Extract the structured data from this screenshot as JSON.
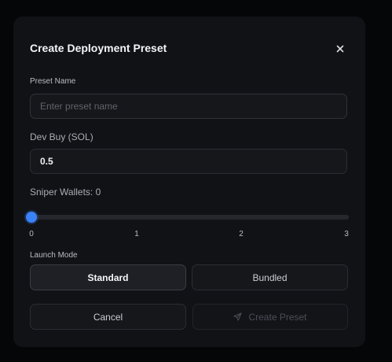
{
  "dialog": {
    "title": "Create Deployment Preset",
    "close_icon": "close-icon"
  },
  "preset_name": {
    "label": "Preset Name",
    "value": "",
    "placeholder": "Enter preset name"
  },
  "dev_buy": {
    "label": "Dev Buy (SOL)",
    "value": "0.5"
  },
  "sniper_wallets": {
    "label": "Sniper Wallets: 0",
    "value": 0,
    "min": 0,
    "max": 3,
    "ticks": [
      "0",
      "1",
      "2",
      "3"
    ]
  },
  "launch_mode": {
    "label": "Launch Mode",
    "options": [
      "Standard",
      "Bundled"
    ],
    "selected": "Standard"
  },
  "actions": {
    "cancel_label": "Cancel",
    "create_label": "Create Preset",
    "create_icon": "send-icon"
  },
  "colors": {
    "accent": "#3b82f6",
    "modal_bg": "#111216",
    "page_bg": "#050608"
  }
}
